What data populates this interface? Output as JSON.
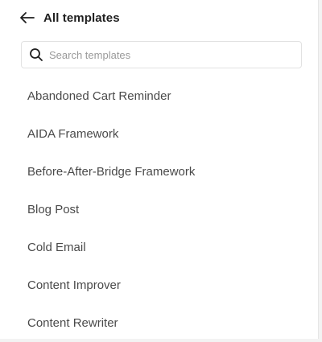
{
  "header": {
    "back_icon": "arrow-left-icon",
    "title": "All templates"
  },
  "search": {
    "icon": "search-icon",
    "placeholder": "Search templates",
    "value": ""
  },
  "templates": [
    {
      "label": "Abandoned Cart Reminder"
    },
    {
      "label": "AIDA Framework"
    },
    {
      "label": "Before-After-Bridge Framework"
    },
    {
      "label": "Blog Post"
    },
    {
      "label": "Cold Email"
    },
    {
      "label": "Content Improver"
    },
    {
      "label": "Content Rewriter"
    }
  ],
  "colors": {
    "text_primary": "#1f1f1f",
    "text_item": "#4a4a4a",
    "placeholder": "#9a9a9a",
    "border": "#e2e2e2"
  }
}
